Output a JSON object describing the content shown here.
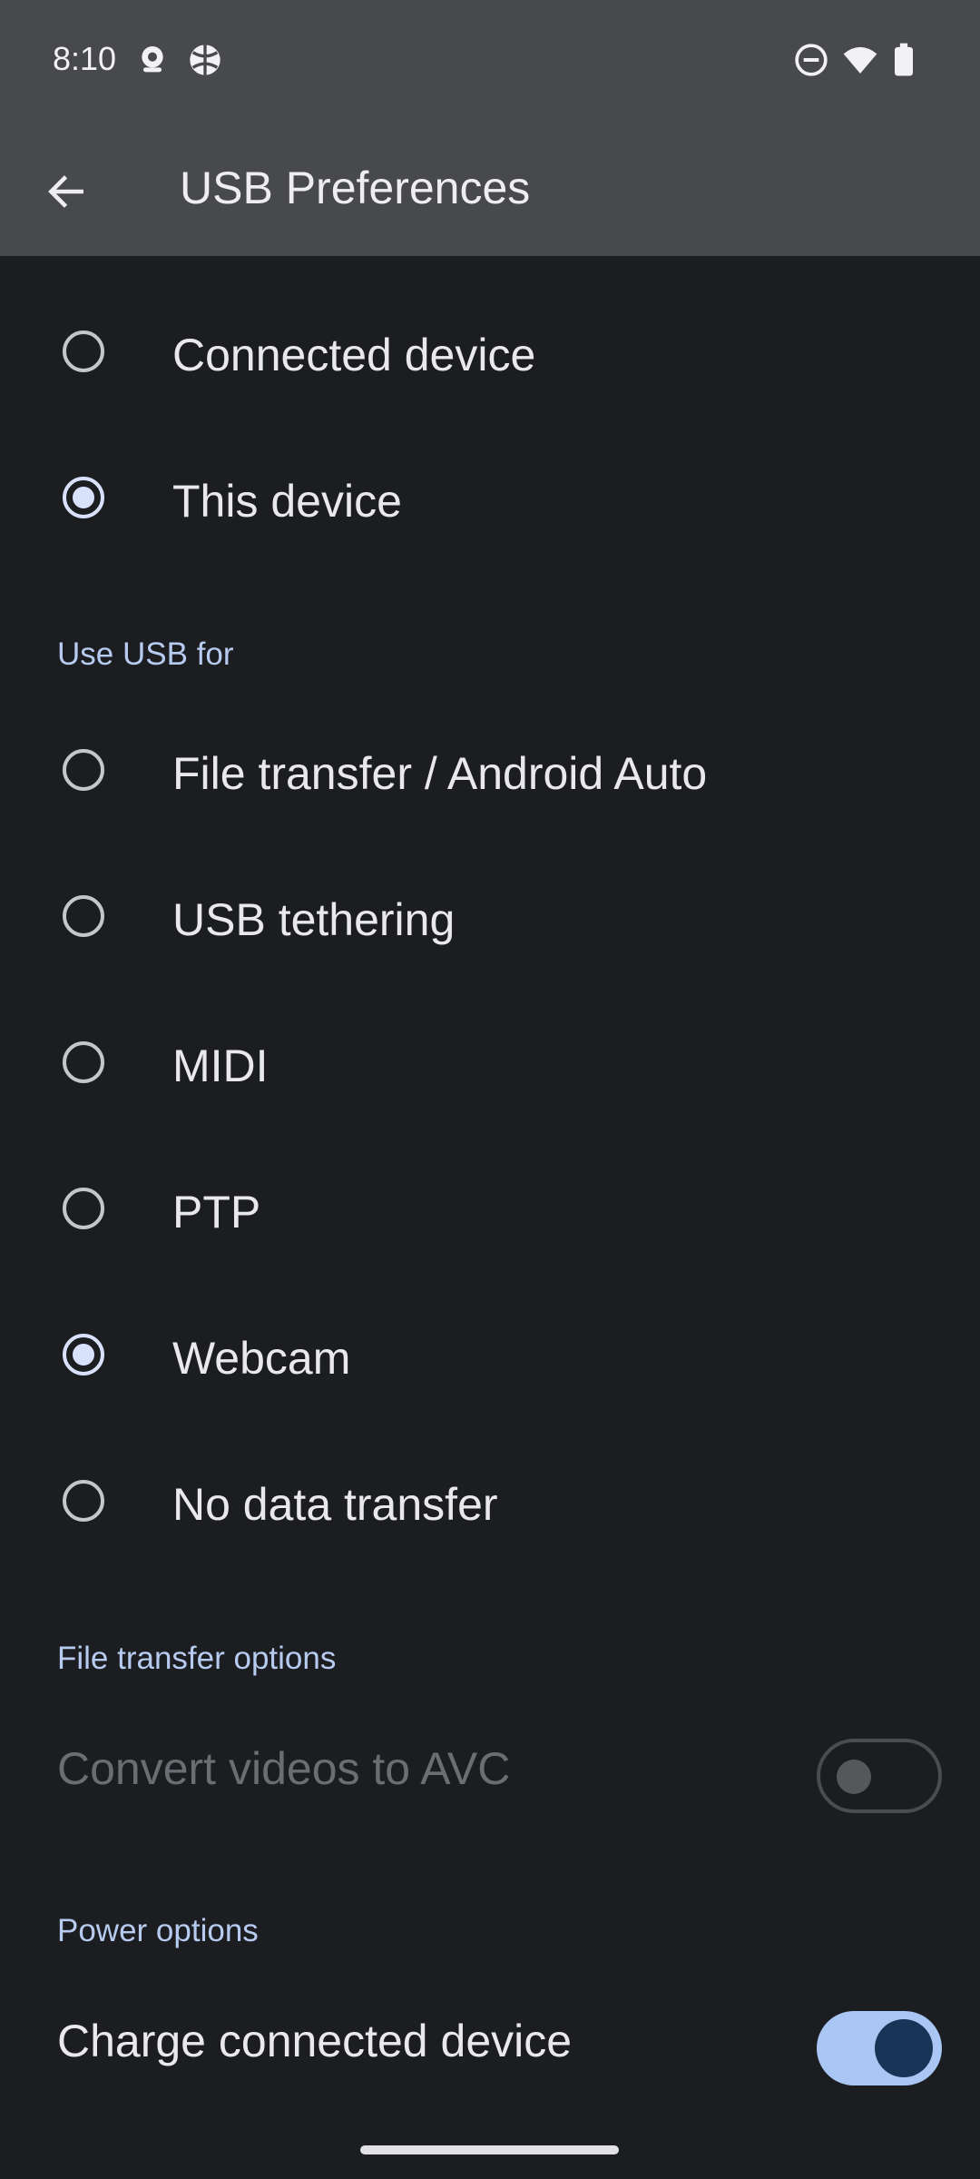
{
  "status_bar": {
    "time": "8:10",
    "icons": [
      "webcam-notification-icon",
      "basketball-notification-icon",
      "do-not-disturb-icon",
      "wifi-icon",
      "battery-icon"
    ]
  },
  "app_bar": {
    "title": "USB Preferences",
    "back_icon": "arrow-back-icon"
  },
  "usb_controlled_by": {
    "options": [
      {
        "label": "Connected device",
        "selected": false
      },
      {
        "label": "This device",
        "selected": true
      }
    ]
  },
  "use_usb_for": {
    "header": "Use USB for",
    "options": [
      {
        "label": "File transfer / Android Auto",
        "selected": false
      },
      {
        "label": "USB tethering",
        "selected": false
      },
      {
        "label": "MIDI",
        "selected": false
      },
      {
        "label": "PTP",
        "selected": false
      },
      {
        "label": "Webcam",
        "selected": true
      },
      {
        "label": "No data transfer",
        "selected": false
      }
    ]
  },
  "file_transfer_options": {
    "header": "File transfer options",
    "convert_videos": {
      "label": "Convert videos to AVC",
      "enabled": false,
      "on": false
    }
  },
  "power_options": {
    "header": "Power options",
    "charge_connected": {
      "label": "Charge connected device",
      "enabled": true,
      "on": true
    }
  },
  "colors": {
    "background": "#1b1d20",
    "app_bar": "#48494c",
    "accent": "#a9c6f5",
    "section_header": "#b7cbf0"
  }
}
